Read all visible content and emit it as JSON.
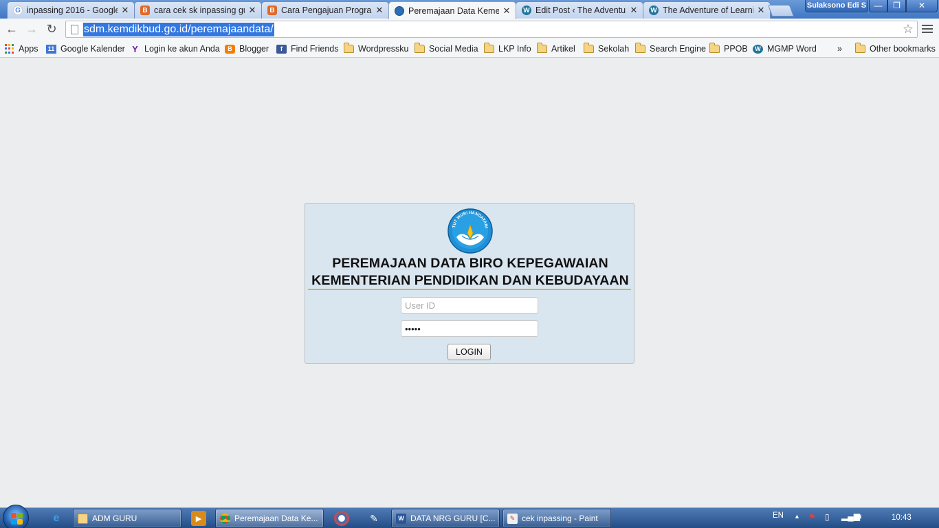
{
  "browser": {
    "tabs": [
      {
        "title": "inpassing 2016 - Google",
        "icon": "google-icon",
        "active": false
      },
      {
        "title": "cara cek sk inpassing gu",
        "icon": "blogger-favicon-icon",
        "active": false
      },
      {
        "title": "Cara Pengajuan Program",
        "icon": "blogger-favicon-icon",
        "active": false
      },
      {
        "title": "Peremajaan Data Kemen",
        "icon": "kemdikbud-icon",
        "active": true
      },
      {
        "title": "Edit Post ‹ The Adventur",
        "icon": "wordpress-icon",
        "active": false
      },
      {
        "title": "The Adventure of Learni",
        "icon": "wordpress-icon",
        "active": false
      }
    ],
    "profile_name": "Sulaksono Edi S",
    "url": "sdm.kemdikbud.go.id/peremajaandata/",
    "bookmarks": [
      {
        "label": "Apps",
        "icon": "apps-grid-icon"
      },
      {
        "label": "Google Kalender",
        "icon": "calendar-icon",
        "badge": "11"
      },
      {
        "label": "Login ke akun Anda",
        "icon": "yahoo-icon"
      },
      {
        "label": "Blogger",
        "icon": "blogger-icon"
      },
      {
        "label": "Find Friends",
        "icon": "facebook-icon"
      },
      {
        "label": "Wordpressku",
        "icon": "folder-icon"
      },
      {
        "label": "Social Media",
        "icon": "folder-icon"
      },
      {
        "label": "LKP Info",
        "icon": "folder-icon"
      },
      {
        "label": "Artikel",
        "icon": "folder-icon"
      },
      {
        "label": "Sekolah",
        "icon": "folder-icon"
      },
      {
        "label": "Search Engine",
        "icon": "folder-icon"
      },
      {
        "label": "PPOB",
        "icon": "folder-icon"
      },
      {
        "label": "MGMP Word",
        "icon": "wordpress-icon"
      }
    ],
    "overflow_label": "»",
    "other_bookmarks": "Other bookmarks"
  },
  "login": {
    "title_line1": "PEREMAJAAN DATA BIRO KEPEGAWAIAN",
    "title_line2": "KEMENTERIAN PENDIDIKAN DAN KEBUDAYAAN",
    "userid_placeholder": "User ID",
    "userid_value": "",
    "password_value": "•••••",
    "button_label": "LOGIN",
    "logo_motto": "TUT WURI HANDAYANI"
  },
  "taskbar": {
    "tasks": [
      {
        "label": "ADM GURU",
        "icon": "folder-icon"
      },
      {
        "label": "Peremajaan Data Ke...",
        "icon": "chrome-icon"
      },
      {
        "label": "DATA NRG GURU [C...",
        "icon": "word-icon"
      },
      {
        "label": "cek inpassing - Paint",
        "icon": "paint-icon"
      }
    ],
    "language": "EN",
    "clock": "10:43"
  },
  "colors": {
    "card_bg": "#d9e5ef",
    "underline": "#e5b21c",
    "url_selection": "#3377e0",
    "tab_strip": "#3f77c3"
  }
}
